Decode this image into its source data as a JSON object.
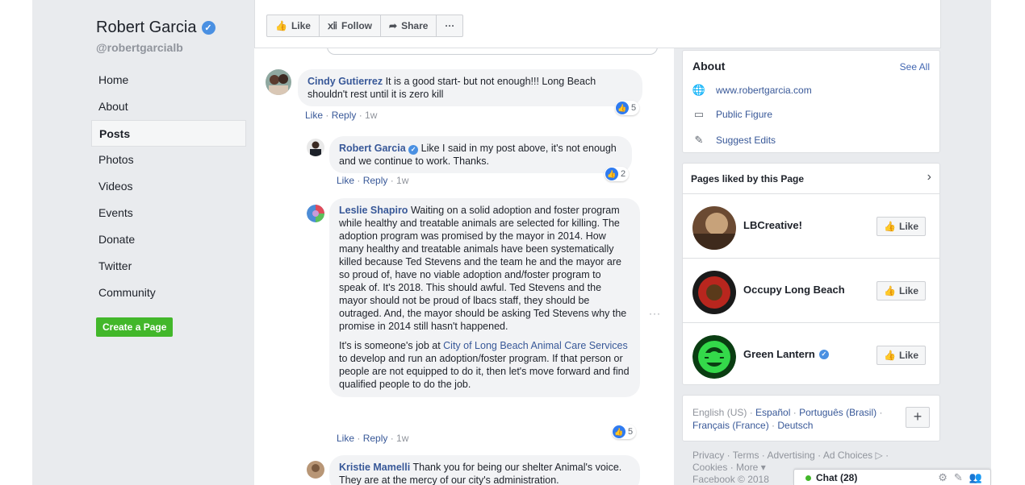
{
  "page": {
    "name": "Robert Garcia",
    "handle": "@robertgarcialb"
  },
  "nav": {
    "items": [
      "Home",
      "About",
      "Posts",
      "Photos",
      "Videos",
      "Events",
      "Donate",
      "Twitter",
      "Community"
    ],
    "active": "Posts",
    "create_page": "Create a Page"
  },
  "actions": {
    "like": "Like",
    "follow": "Follow",
    "share": "Share",
    "more": "···"
  },
  "comments": [
    {
      "author": "Cindy Gutierrez",
      "text": "It is a good start- but not enough!!! Long Beach shouldn't rest until it is zero kill",
      "like": "Like",
      "reply": "Reply",
      "time": "1w",
      "reactions": "5"
    },
    {
      "author": "Robert Garcia",
      "text": "Like I said in my post above, it's not enough and we continue to work. Thanks.",
      "like": "Like",
      "reply": "Reply",
      "time": "1w",
      "reactions": "2"
    },
    {
      "author": "Leslie Shapiro",
      "text": "Waiting on a solid adoption and foster program while healthy and treatable animals are selected for killing. The adoption program was promised by the mayor in 2014. How many healthy and treatable animals have been systematically killed because Ted Stevens and the team he and the mayor are so proud of, have no viable adoption and/foster program to speak of. It's 2018. This should awful. Ted Stevens and the mayor should not be proud of lbacs staff, they should be outraged. And, the mayor should be asking Ted Stevens why the promise in 2014 still hasn't happened.",
      "text2_pre": "It's is someone's job at ",
      "text2_link": "City of Long Beach Animal Care Services",
      "text2_post": " to develop and run an adoption/foster program. If that person or people are not equipped to do it, then let's move forward and find qualified people to do the job.",
      "like": "Like",
      "reply": "Reply",
      "time": "1w",
      "reactions": "5"
    },
    {
      "author": "Kristie Mamelli",
      "text": "Thank you for being our shelter Animal's voice. They are at the mercy of our city's administration."
    }
  ],
  "about": {
    "title": "About",
    "see_all": "See All",
    "website": "www.robertgarcia.com",
    "category": "Public Figure",
    "suggest": "Suggest Edits"
  },
  "liked_pages": {
    "title": "Pages liked by this Page",
    "items": [
      {
        "name": "LBCreative!",
        "like": "Like"
      },
      {
        "name": "Occupy Long Beach",
        "like": "Like"
      },
      {
        "name": "Green Lantern",
        "like": "Like"
      }
    ]
  },
  "languages": {
    "current": "English (US)",
    "others": [
      "Español",
      "Português (Brasil)",
      "Français (France)",
      "Deutsch"
    ]
  },
  "footer": {
    "line1": "Privacy · Terms · Advertising · Ad Choices ▷ ·",
    "line2": "Cookies · More ▾",
    "line3": "Facebook © 2018"
  },
  "chat": {
    "label": "Chat (28)"
  },
  "colors": {
    "link": "#385898",
    "create_button": "#42b72a",
    "verified": "#4a90e2"
  }
}
